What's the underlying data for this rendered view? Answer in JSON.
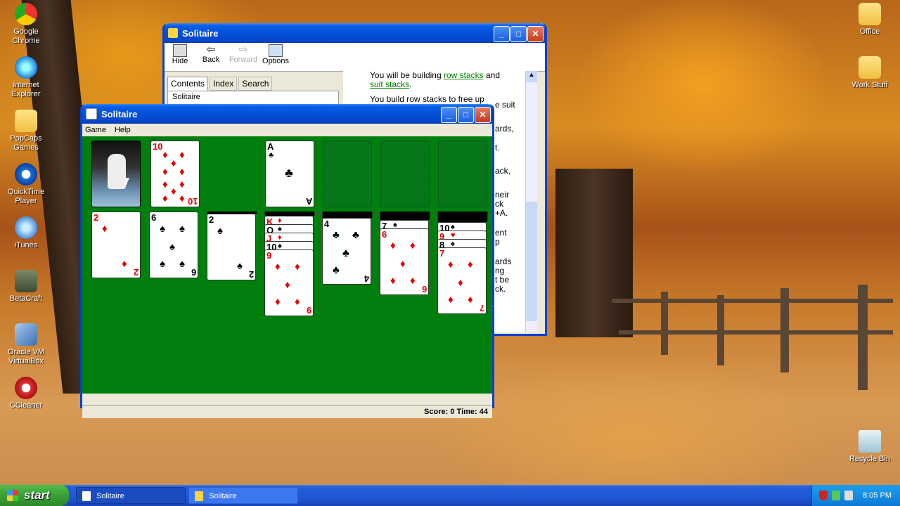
{
  "desktop": {
    "left_icons": [
      {
        "label": "Google Chrome",
        "icon": "chrome-icon"
      },
      {
        "label": "Internet Explorer",
        "icon": "ie-icon"
      },
      {
        "label": "PopCaps Games",
        "icon": "folder-icon"
      },
      {
        "label": "QuickTime Player",
        "icon": "quicktime-icon"
      },
      {
        "label": "iTunes",
        "icon": "itunes-icon"
      },
      {
        "label": "BetaCraft",
        "icon": "betacraft-icon"
      },
      {
        "label": "Oracle VM VirtualBox",
        "icon": "virtualbox-icon"
      },
      {
        "label": "CCleaner",
        "icon": "ccleaner-icon"
      }
    ],
    "right_icons": [
      {
        "label": "Office",
        "icon": "folder-icon"
      },
      {
        "label": "Work Stuff",
        "icon": "folder-icon"
      },
      {
        "label": "Recycle Bin",
        "icon": "recycle-bin-icon"
      }
    ]
  },
  "help_window": {
    "title": "Solitaire",
    "toolbar": {
      "hide": "Hide",
      "back": "Back",
      "forward": "Forward",
      "options": "Options"
    },
    "tabs": [
      "Contents",
      "Index",
      "Search"
    ],
    "tree_item": "Solitaire",
    "content_lines": [
      "You will be building row stacks and",
      "suit stacks.",
      "You build row stacks to free up",
      "e suit",
      "ards,",
      "t.",
      "ack,",
      "neir",
      "ck",
      "+A.",
      "ent",
      "p",
      "ards",
      "ng",
      "t be",
      "ck."
    ],
    "links": [
      "row stacks",
      "suit stacks"
    ]
  },
  "game_window": {
    "title": "Solitaire",
    "menu": [
      "Game",
      "Help"
    ],
    "status": {
      "score_label": "Score:",
      "score": "0",
      "time_label": "Time:",
      "time": "44"
    },
    "waste_card": {
      "rank": "10",
      "suit": "♦"
    },
    "foundations": [
      {
        "rank": "A",
        "suit": "♣"
      },
      null,
      null,
      null
    ],
    "tableau": [
      {
        "hidden": 0,
        "faceup": [
          {
            "rank": "2",
            "suit": "♦"
          }
        ]
      },
      {
        "hidden": 0,
        "faceup": [
          {
            "rank": "6",
            "suit": "♠"
          }
        ]
      },
      {
        "hidden": 1,
        "faceup": [
          {
            "rank": "2",
            "suit": "♠"
          }
        ]
      },
      {
        "hidden": 2,
        "faceup": [
          {
            "rank": "K",
            "suit": "♦"
          },
          {
            "rank": "Q",
            "suit": "♠"
          },
          {
            "rank": "J",
            "suit": "♦"
          },
          {
            "rank": "10",
            "suit": "♠"
          },
          {
            "rank": "9",
            "suit": "♦"
          }
        ]
      },
      {
        "hidden": 3,
        "faceup": [
          {
            "rank": "4",
            "suit": "♣"
          }
        ]
      },
      {
        "hidden": 4,
        "faceup": [
          {
            "rank": "7",
            "suit": "♠"
          },
          {
            "rank": "6",
            "suit": "♦"
          }
        ]
      },
      {
        "hidden": 5,
        "faceup": [
          {
            "rank": "10",
            "suit": "♠"
          },
          {
            "rank": "9",
            "suit": "♥"
          },
          {
            "rank": "8",
            "suit": "♠"
          },
          {
            "rank": "7",
            "suit": "♦"
          }
        ]
      }
    ]
  },
  "taskbar": {
    "start": "start",
    "tasks": [
      "Solitaire",
      "Solitaire"
    ],
    "clock": "8:05 PM"
  },
  "colors": {
    "felt": "#007f0e",
    "title_blue": "#0550d8",
    "taskbar_blue": "#245edb",
    "start_green": "#3a9e36"
  }
}
